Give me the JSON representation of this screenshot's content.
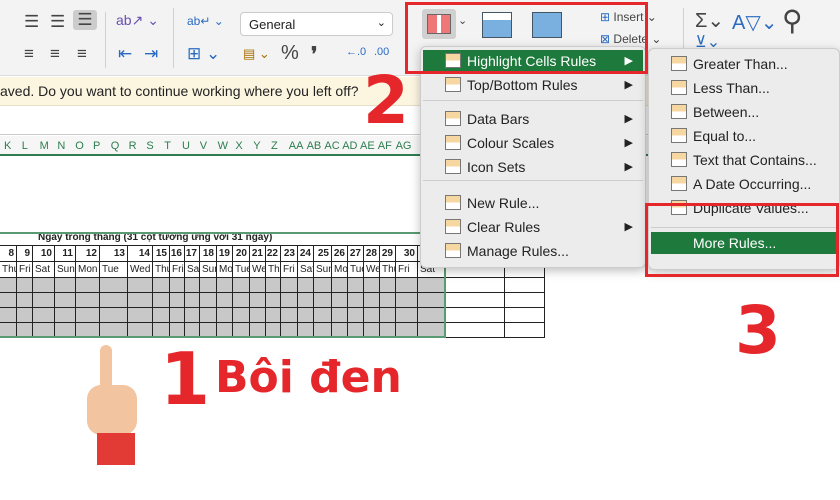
{
  "toolbar": {
    "number_format": "General",
    "percent": "%",
    "comma": "❜",
    "insert_label": "Insert",
    "delete_label": "Delete",
    "icons": [
      "align-top-icon",
      "align-middle-icon",
      "align-bottom-icon",
      "orientation-icon",
      "wrap-text-icon",
      "align-left-icon",
      "align-center-icon",
      "align-right-icon",
      "decrease-indent-icon",
      "increase-indent-icon",
      "merge-icon",
      "currency-icon",
      "increase-decimal-icon",
      "decrease-decimal-icon",
      "conditional-formatting-icon",
      "format-as-table-icon",
      "cell-styles-icon",
      "autosum-icon",
      "fill-icon",
      "sort-filter-icon",
      "find-icon"
    ]
  },
  "notice": {
    "text": "aved. Do you want to continue working where you left off?"
  },
  "columns": [
    "K",
    "L",
    "M",
    "N",
    "O",
    "P",
    "Q",
    "R",
    "S",
    "T",
    "U",
    "V",
    "W",
    "X",
    "Y",
    "Z",
    "AA",
    "AB",
    "AC",
    "AD",
    "AE",
    "AF",
    "AG"
  ],
  "sheet": {
    "title": "Ngày trong tháng (31 cột tương ứng với 31 ngày)",
    "day_numbers": [
      "8",
      "9",
      "10",
      "11",
      "12",
      "13",
      "14",
      "15",
      "16",
      "17",
      "18",
      "19",
      "20",
      "21",
      "22",
      "23",
      "24",
      "25",
      "26",
      "27",
      "28",
      "29",
      "30",
      ""
    ],
    "weekdays": [
      "Thu",
      "Fri",
      "Sat",
      "Sun",
      "Mon",
      "Tue",
      "Wed",
      "Thu",
      "Fri",
      "Sat",
      "Sun",
      "Mon",
      "Tue",
      "Wed",
      "Thu",
      "Fri",
      "Sat",
      "Sun",
      "Mon",
      "Tue",
      "Wed",
      "Thu",
      "Fri",
      "Sat"
    ]
  },
  "menu": {
    "items": [
      {
        "label": "Highlight Cells Rules",
        "submenu": true,
        "selected": true
      },
      {
        "label": "Top/Bottom Rules",
        "submenu": true
      },
      {
        "label": "Data Bars",
        "submenu": true
      },
      {
        "label": "Colour Scales",
        "submenu": true
      },
      {
        "label": "Icon Sets",
        "submenu": true
      },
      {
        "label": "New Rule...",
        "submenu": false
      },
      {
        "label": "Clear Rules",
        "submenu": true
      },
      {
        "label": "Manage Rules...",
        "submenu": false
      }
    ]
  },
  "submenu": {
    "items": [
      "Greater Than...",
      "Less Than...",
      "Between...",
      "Equal to...",
      "Text that Contains...",
      "A Date Occurring...",
      "Duplicate Values..."
    ],
    "more": "More Rules..."
  },
  "annotations": {
    "step1": "1",
    "step1_text": "Bôi đen",
    "step2": "2",
    "step3": "3"
  },
  "colors": {
    "accent": "#1e7a3c",
    "annotation": "#e5262a",
    "selection": "#c8c8c8"
  }
}
